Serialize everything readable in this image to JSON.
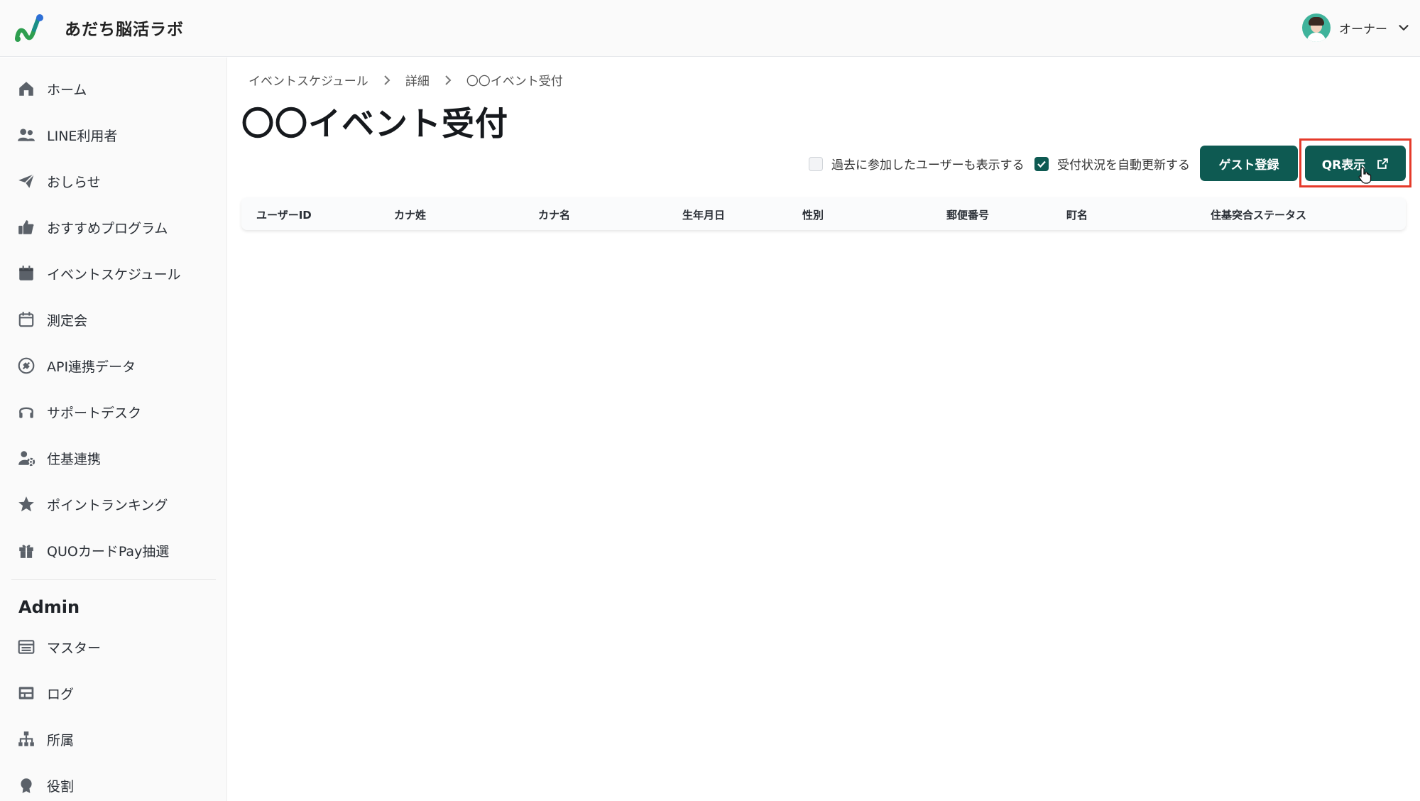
{
  "header": {
    "app_title": "あだち脳活ラボ",
    "user_name": "オーナー",
    "brand_colors": {
      "logo_green": "#2e9e4f",
      "logo_blue": "#2d6fd6",
      "logo_teal": "#1a8f86"
    }
  },
  "sidebar": {
    "items": [
      {
        "label": "ホーム",
        "icon": "home-icon"
      },
      {
        "label": "LINE利用者",
        "icon": "users-icon"
      },
      {
        "label": "おしらせ",
        "icon": "paper-plane-icon"
      },
      {
        "label": "おすすめプログラム",
        "icon": "thumbs-up-icon"
      },
      {
        "label": "イベントスケジュール",
        "icon": "calendar-icon"
      },
      {
        "label": "測定会",
        "icon": "calendar-outline-icon"
      },
      {
        "label": "API連携データ",
        "icon": "plug-icon"
      },
      {
        "label": "サポートデスク",
        "icon": "headset-icon"
      },
      {
        "label": "住基連携",
        "icon": "user-gear-icon"
      },
      {
        "label": "ポイントランキング",
        "icon": "star-icon"
      },
      {
        "label": "QUOカードPay抽選",
        "icon": "gift-icon"
      }
    ],
    "admin_heading": "Admin",
    "admin_items": [
      {
        "label": "マスター",
        "icon": "list-icon"
      },
      {
        "label": "ログ",
        "icon": "log-icon"
      },
      {
        "label": "所属",
        "icon": "sitemap-icon"
      },
      {
        "label": "役割",
        "icon": "badge-icon"
      }
    ]
  },
  "breadcrumb": [
    "イベントスケジュール",
    "詳細",
    "〇〇イベント受付"
  ],
  "page_title": "〇〇イベント受付",
  "toolbar": {
    "show_past_users_label": "過去に参加したユーザーも表示する",
    "show_past_users_checked": false,
    "auto_refresh_label": "受付状況を自動更新する",
    "auto_refresh_checked": true,
    "guest_register_label": "ゲスト登録",
    "qr_display_label": "QR表示",
    "button_color": "#0e5a52",
    "highlight_color": "#e53a2a"
  },
  "table": {
    "columns": [
      "ユーザーID",
      "カナ姓",
      "カナ名",
      "生年月日",
      "性別",
      "郵便番号",
      "町名",
      "住基突合ステータス"
    ],
    "rows": []
  }
}
